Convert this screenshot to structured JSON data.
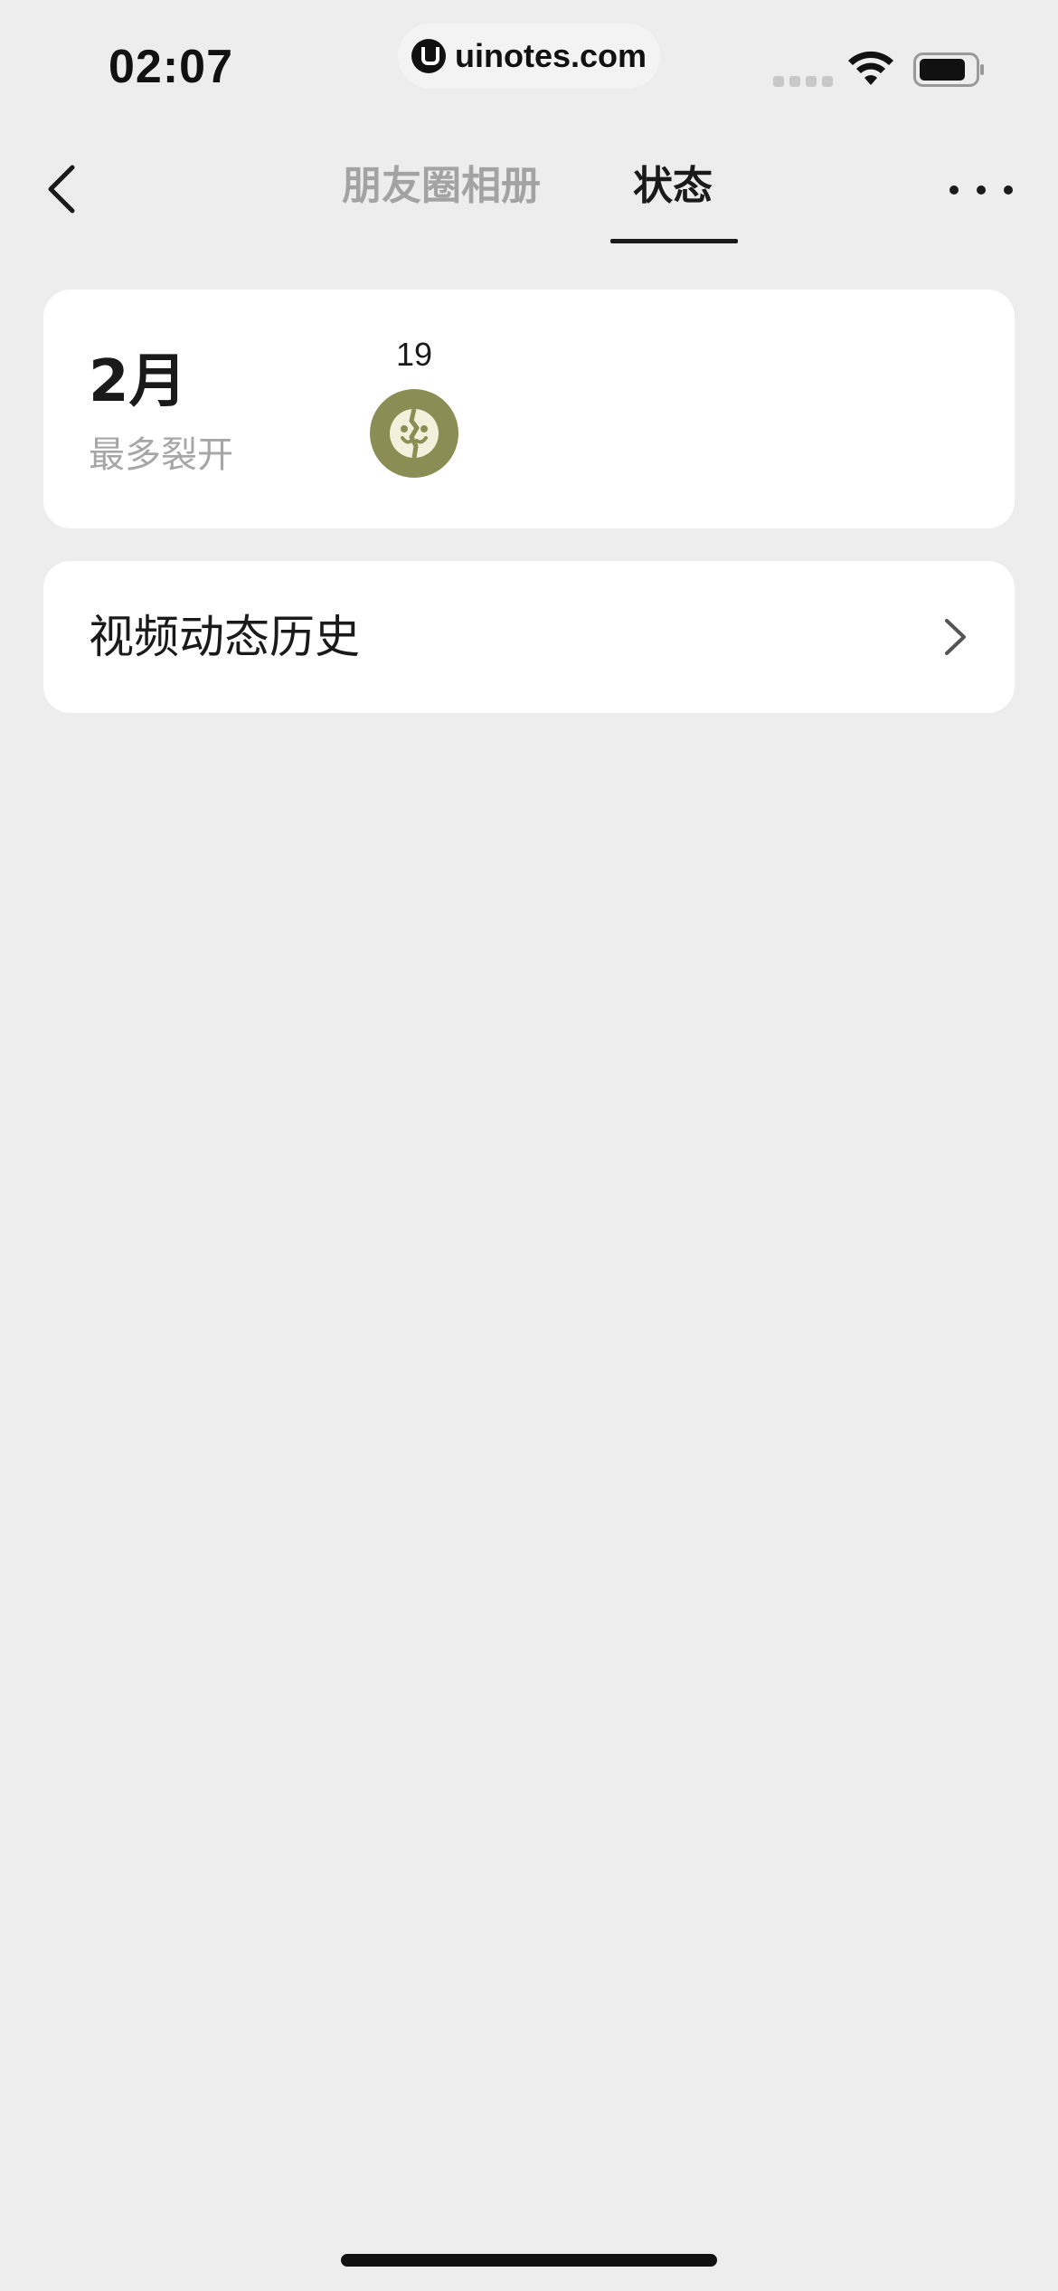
{
  "status_bar": {
    "time": "02:07",
    "url": "uinotes.com"
  },
  "nav": {
    "tabs": [
      {
        "label": "朋友圈相册",
        "active": false
      },
      {
        "label": "状态",
        "active": true
      }
    ]
  },
  "month_card": {
    "month": "2月",
    "subtitle": "最多裂开",
    "entries": [
      {
        "day": "19",
        "icon": "split-face-status-icon"
      }
    ]
  },
  "history": {
    "label": "视频动态历史"
  },
  "colors": {
    "background": "#ededed",
    "card": "#ffffff",
    "inactive_tab": "#a3a3a3",
    "status_avatar": "#8a8e55"
  }
}
